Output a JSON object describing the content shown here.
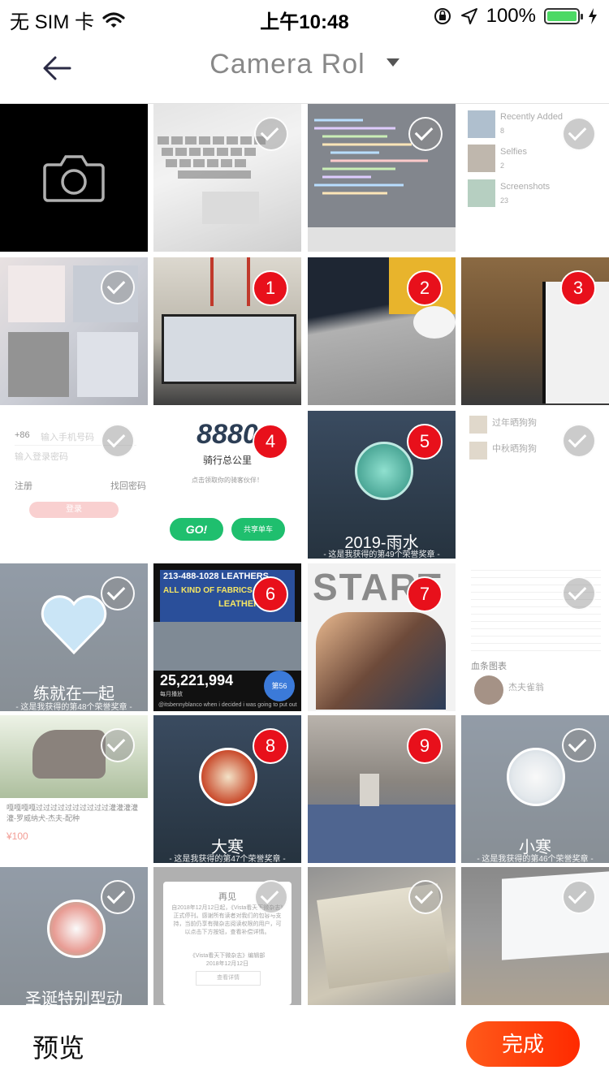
{
  "status_bar": {
    "carrier": "无 SIM 卡",
    "time": "上午10:48",
    "battery": "100%"
  },
  "nav": {
    "title": "Camera Rol"
  },
  "grid": {
    "row1": {
      "album_menu": [
        {
          "label": "Recently Added",
          "count": "8"
        },
        {
          "label": "Selfies",
          "count": "2"
        },
        {
          "label": "Screenshots",
          "count": "23"
        }
      ]
    },
    "row2": {
      "badges": [
        "1",
        "2",
        "3"
      ]
    },
    "row3": {
      "login": {
        "code": "+86",
        "phone_ph": "输入手机号码",
        "pwd_ph": "输入登录密码",
        "register": "注册",
        "forgot": "找回密码",
        "btn": "登录"
      },
      "ride": {
        "number": "8880",
        "label": "骑行总公里",
        "sub": "点击领取你的骑客伙伴！",
        "go": "GO!",
        "share": "共享单车",
        "badge": "4"
      },
      "yushui": {
        "title": "2019-雨水",
        "sub": "- 这是我获得的第49个荣誉奖章 -",
        "badge": "5"
      },
      "list": {
        "item1": "过年晒狗狗",
        "item2": "中秋晒狗狗"
      }
    },
    "row4": {
      "heart": {
        "title": "练就在一起",
        "sub": "- 这是我获得的第48个荣誉奖章 -"
      },
      "leather": {
        "sign1": "213-488-1028 LEATHERS",
        "sign2": "ALL KIND OF FABRICS",
        "sign3": "LEATHERS",
        "count": "25,221,994",
        "count_sub": "每月播放",
        "rank": "第56",
        "caption": "@itsbennyblanco when i decided i was going to put out",
        "badge": "6"
      },
      "anime": {
        "start": "START",
        "badge": "7"
      },
      "article": {
        "chart_label": "血条图表",
        "name": "杰夫雀翁"
      }
    },
    "row5": {
      "dog": {
        "desc": "嘎嘎嘎嘎过过过过过过过过过过灌灌灌灌灌-罗威纳犬-杰夫-配种",
        "price": "¥100"
      },
      "dahan": {
        "title": "大寒",
        "sub": "- 这是我获得的第47个荣誉奖章 -",
        "badge": "8"
      },
      "room": {
        "badge": "9"
      },
      "xiaohan": {
        "title": "小寒",
        "sub": "- 这是我获得的第46个荣誉奖章 -"
      }
    },
    "row6": {
      "christmas": {
        "title": "圣诞特别型动"
      },
      "farewell": {
        "title": "再见",
        "body": "自2018年12月12日起，《Vista看天下微杂志》正式停刊。感谢所有读者对我们的包容与支持，当前仍享有微杂志阅读权限的用户，可以点击下方按钮，查看补偿详情。",
        "sign": "《Vista看天下微杂志》编辑部",
        "date": "2018年12月12日",
        "btn": "查看详情"
      }
    }
  },
  "bottom": {
    "preview": "预览",
    "done": "完成"
  },
  "colors": {
    "accent": "#ff3c00",
    "badge": "#e8101b"
  }
}
